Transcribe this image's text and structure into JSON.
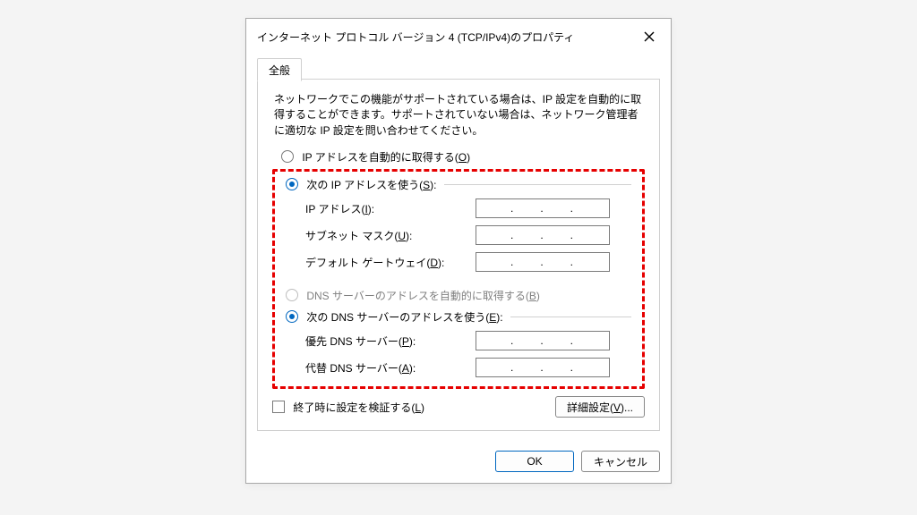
{
  "window": {
    "title": "インターネット プロトコル バージョン 4 (TCP/IPv4)のプロパティ"
  },
  "tab": {
    "general": "全般"
  },
  "description": "ネットワークでこの機能がサポートされている場合は、IP 設定を自動的に取得することができます。サポートされていない場合は、ネットワーク管理者に適切な IP 設定を問い合わせてください。",
  "ip": {
    "auto": {
      "pre": "IP アドレスを自動的に取得する(",
      "accel": "O",
      "post": ")"
    },
    "manual": {
      "pre": "次の IP アドレスを使う(",
      "accel": "S",
      "post": "):"
    },
    "addr": {
      "pre": "IP アドレス(",
      "accel": "I",
      "post": "):"
    },
    "mask": {
      "pre": "サブネット マスク(",
      "accel": "U",
      "post": "):"
    },
    "gw": {
      "pre": "デフォルト ゲートウェイ(",
      "accel": "D",
      "post": "):"
    }
  },
  "dns": {
    "auto": {
      "pre": "DNS サーバーのアドレスを自動的に取得する(",
      "accel": "B",
      "post": ")"
    },
    "manual": {
      "pre": "次の DNS サーバーのアドレスを使う(",
      "accel": "E",
      "post": "):"
    },
    "pref": {
      "pre": "優先 DNS サーバー(",
      "accel": "P",
      "post": "):"
    },
    "alt": {
      "pre": "代替 DNS サーバー(",
      "accel": "A",
      "post": "):"
    }
  },
  "validate": {
    "pre": "終了時に設定を検証する(",
    "accel": "L",
    "post": ")"
  },
  "buttons": {
    "advanced": {
      "pre": "詳細設定(",
      "accel": "V",
      "post": ")..."
    },
    "ok": "OK",
    "cancel": "キャンセル"
  }
}
